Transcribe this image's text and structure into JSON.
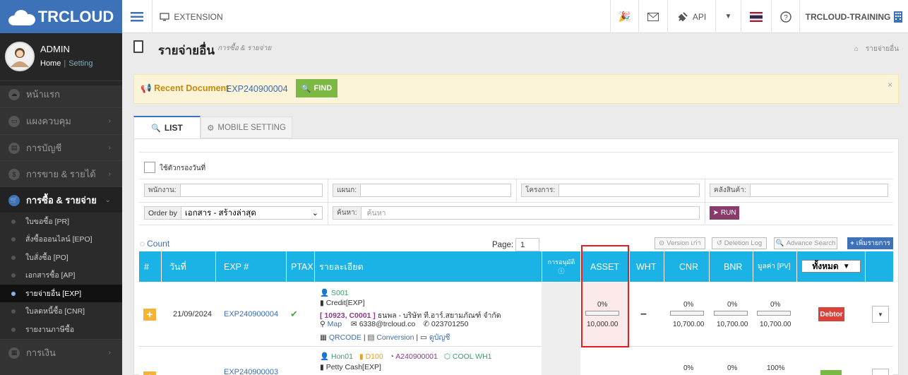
{
  "brand": {
    "logo_text": "TRCLOUD"
  },
  "user": {
    "name": "ADMIN",
    "home": "Home",
    "sep": "|",
    "setting": "Setting"
  },
  "sidebar": {
    "items": [
      {
        "label": "หน้าแรก"
      },
      {
        "label": "แผงควบคุม"
      },
      {
        "label": "การบัญชี"
      },
      {
        "label": "การขาย & รายได้"
      },
      {
        "label": "การซื้อ & รายจ่าย"
      },
      {
        "label": "การเงิน"
      }
    ],
    "sub_items": [
      {
        "label": "ใบขอซื้อ [PR]"
      },
      {
        "label": "สั่งซื้อออนไลน์ [EPO]"
      },
      {
        "label": "ใบสั่งซื้อ [PO]"
      },
      {
        "label": "เอกสารซื้อ [AP]"
      },
      {
        "label": "รายจ่ายอื่น [EXP]"
      },
      {
        "label": "ใบลดหนี้ซื้อ [CNR]"
      },
      {
        "label": "รายงานภาษีซื้อ"
      }
    ]
  },
  "topbar": {
    "extension": "EXTENSION",
    "api": "API",
    "account": "TRCLOUD-TRAINING"
  },
  "page": {
    "title": "รายจ่ายอื่น",
    "subtitle": "การซื้อ & รายจ่าย",
    "breadcrumb": "รายจ่ายอื่น"
  },
  "recent": {
    "label": "Recent Document",
    "doc": "EXP240900004",
    "find": "FIND",
    "close": "×"
  },
  "tabs": {
    "list": "LIST",
    "mobile": "MOBILE SETTING"
  },
  "filters": {
    "date_filter_label": "ใช้ตัวกรองวันที่",
    "employee": "พนักงาน:",
    "department": "แผนก:",
    "project": "โครงการ:",
    "warehouse": "คลังสินค้า:",
    "order_by": "Order by",
    "order_value": "เอกสาร - สร้างล่าสุด",
    "search_label": "ค้นหา:",
    "search_placeholder": "ค้นหา",
    "run": "RUN"
  },
  "toolbar": {
    "count": "Count",
    "page_label": "Page:",
    "page_value": "1",
    "version": "Version เก่า",
    "deletion_log": "Deletion Log",
    "advance_search": "Advance Search",
    "add": "เพิ่มรายการ"
  },
  "table": {
    "headers": {
      "num": "#",
      "date": "วันที่",
      "exp": "EXP #",
      "ptax": "PTAX",
      "detail": "รายละเอียด",
      "approve": "การอนุมัติ",
      "asset": "ASSET",
      "wht": "WHT",
      "cnr": "CNR",
      "bnr": "BNR",
      "value": "มูลค่า [PV]",
      "filter": "ทั้งหมด"
    },
    "rows": [
      {
        "date": "21/09/2024",
        "exp": "EXP240900004",
        "ptax": "✔",
        "detail": {
          "line1": "S001",
          "line2": "Credit[EXP]",
          "line3_code": "[ 10923, C0001 ]",
          "line3_name": "ธนพล - บริษัท ที.อาร์.สยามภัณฑ์ จำกัด",
          "map": "Map",
          "email": "6338@trcloud.co",
          "phone": "023701250",
          "qrcode": "QRCODE",
          "conversion": "Conversion",
          "view": "ดูบัญชี"
        },
        "asset_pct": "0%",
        "asset_amt": "10,000.00",
        "wht": "–",
        "cnr_pct": "0%",
        "cnr_amt": "10,700.00",
        "bnr_pct": "0%",
        "bnr_amt": "10,700.00",
        "val_pct": "0%",
        "val_amt": "10,700.00",
        "status": "Debtor"
      },
      {
        "exp": "EXP240900003",
        "detail": {
          "tag1": "Hon01",
          "tag2": "D100",
          "tag3": "A240900001",
          "tag4": "COOL WH1",
          "line2": "Petty Cash[EXP]"
        },
        "cnr_pct": "0%",
        "bnr_pct": "0%",
        "val_pct": "100%"
      }
    ]
  },
  "colors": {
    "sidebar": "#333333",
    "brand_blue": "#3d71b8",
    "table_header": "#1bb3e5",
    "find_green": "#7cb844",
    "debtor_red": "#d9413a",
    "highlight": "#e02020"
  }
}
